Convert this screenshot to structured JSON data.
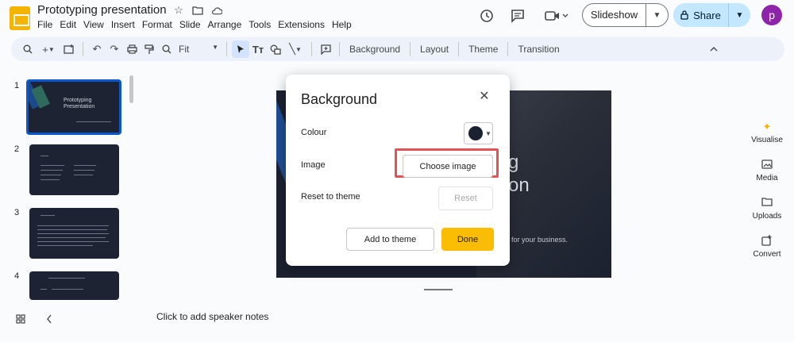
{
  "app": {
    "title": "Prototyping presentation",
    "menu": [
      "File",
      "Edit",
      "View",
      "Insert",
      "Format",
      "Slide",
      "Arrange",
      "Tools",
      "Extensions",
      "Help"
    ]
  },
  "header": {
    "slideshow_label": "Slideshow",
    "share_label": "Share",
    "avatar_initial": "p",
    "accent_color": "#c2e7ff",
    "avatar_color": "#8e24aa"
  },
  "toolbar": {
    "zoom": "Fit",
    "background_label": "Background",
    "layout_label": "Layout",
    "theme_label": "Theme",
    "transition_label": "Transition"
  },
  "filmstrip": {
    "slides": [
      {
        "number": "1",
        "title": "Prototyping Presentation"
      },
      {
        "number": "2",
        "title": ""
      },
      {
        "number": "3",
        "title": ""
      },
      {
        "number": "4",
        "title": ""
      }
    ]
  },
  "slide": {
    "line1": "g",
    "line2": "on",
    "tagline": "tool for your business."
  },
  "side_panel": {
    "items": [
      "Visualise",
      "Media",
      "Uploads",
      "Convert"
    ]
  },
  "notes": {
    "placeholder": "Click to add speaker notes"
  },
  "dialog": {
    "title": "Background",
    "colour_label": "Colour",
    "image_label": "Image",
    "reset_label": "Reset to theme",
    "choose_image": "Choose image",
    "reset_button": "Reset",
    "add_to_theme": "Add to theme",
    "done": "Done",
    "selected_colour": "#1c2130",
    "done_color": "#fbbc04",
    "highlight_color": "#e45357"
  }
}
